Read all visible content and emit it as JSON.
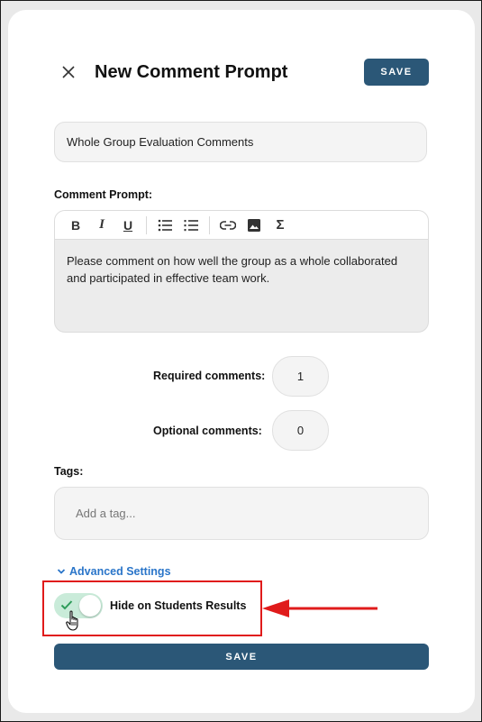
{
  "header": {
    "title": "New Comment Prompt",
    "save_label": "SAVE",
    "close_icon": "close-icon"
  },
  "form": {
    "title_value": "Whole Group Evaluation Comments",
    "comment_prompt_label": "Comment Prompt:",
    "toolbar": [
      {
        "name": "bold-icon",
        "glyph": "B"
      },
      {
        "name": "italic-icon",
        "glyph": "I"
      },
      {
        "name": "underline-icon",
        "glyph": "U"
      },
      {
        "name": "bulleted-list-icon"
      },
      {
        "name": "numbered-list-icon"
      },
      {
        "name": "link-icon"
      },
      {
        "name": "image-icon"
      },
      {
        "name": "sigma-icon",
        "glyph": "Σ"
      }
    ],
    "comment_prompt_text": "Please comment on how well the group as a whole collaborated and participated in effective team work.",
    "required_label": "Required comments:",
    "required_value": "1",
    "optional_label": "Optional comments:",
    "optional_value": "0",
    "tags_label": "Tags:",
    "tags_placeholder": "Add a tag...",
    "advanced_settings_label": "Advanced Settings",
    "hide_label": "Hide on Students Results",
    "hide_enabled": true,
    "save_bottom_label": "SAVE"
  },
  "colors": {
    "primary": "#2b5777",
    "link": "#2a75c9",
    "toggle_on": "#c9ebd9",
    "check": "#2e9c5a",
    "annotation_red": "#e01b1b"
  }
}
